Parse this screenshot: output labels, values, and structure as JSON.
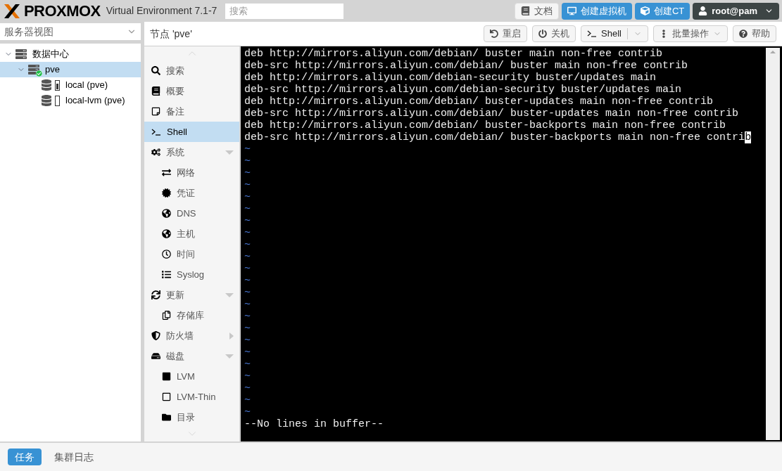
{
  "header": {
    "logo": "PROXMOX",
    "product": "Virtual Environment 7.1-7",
    "search": {
      "placeholder": "搜索"
    },
    "buttons": [
      {
        "label": "文档",
        "kind": "plain"
      },
      {
        "label": "创建虚拟机",
        "kind": "primary"
      },
      {
        "label": "创建CT",
        "kind": "primary"
      },
      {
        "label": "root@pam",
        "kind": "user"
      }
    ]
  },
  "sidebar": {
    "view_select": "服务器视图",
    "tree": [
      {
        "label": "数据中心",
        "expanded": true,
        "selected": false,
        "children": [
          {
            "label": "pve",
            "expanded": true,
            "selected": true,
            "children": [
              {
                "label": "local (pve)",
                "selected": false
              },
              {
                "label": "local-lvm (pve)",
                "selected": false
              }
            ]
          }
        ]
      }
    ]
  },
  "panel": {
    "title": "节点 'pve'",
    "toolbar": [
      {
        "label": "重启",
        "kind": "button"
      },
      {
        "label": "关机",
        "kind": "button"
      },
      {
        "label": "Shell",
        "kind": "split"
      },
      {
        "label": "批量操作",
        "kind": "menu"
      },
      {
        "label": "帮助",
        "kind": "button"
      }
    ]
  },
  "nav": [
    {
      "label": "搜索",
      "kind": "item",
      "selected": false
    },
    {
      "label": "概要",
      "kind": "item",
      "selected": false
    },
    {
      "label": "备注",
      "kind": "item",
      "selected": false
    },
    {
      "label": "Shell",
      "kind": "item",
      "selected": true
    },
    {
      "label": "系统",
      "kind": "group",
      "expanded": true,
      "selected": false
    },
    {
      "label": "网络",
      "kind": "child",
      "selected": false
    },
    {
      "label": "凭证",
      "kind": "child",
      "selected": false
    },
    {
      "label": "DNS",
      "kind": "child",
      "selected": false
    },
    {
      "label": "主机",
      "kind": "child",
      "selected": false
    },
    {
      "label": "时间",
      "kind": "child",
      "selected": false
    },
    {
      "label": "Syslog",
      "kind": "child",
      "selected": false
    },
    {
      "label": "更新",
      "kind": "group",
      "expanded": true,
      "selected": false
    },
    {
      "label": "存储库",
      "kind": "child",
      "selected": false
    },
    {
      "label": "防火墙",
      "kind": "group",
      "expanded": false,
      "selected": false
    },
    {
      "label": "磁盘",
      "kind": "group",
      "expanded": true,
      "selected": false
    },
    {
      "label": "LVM",
      "kind": "child",
      "selected": false
    },
    {
      "label": "LVM-Thin",
      "kind": "child",
      "selected": false
    },
    {
      "label": "目录",
      "kind": "child",
      "selected": false
    }
  ],
  "terminal": {
    "lines": [
      {
        "text": "deb http://mirrors.aliyun.com/debian/ buster main non-free contrib",
        "cursor": false
      },
      {
        "text": "deb-src http://mirrors.aliyun.com/debian/ buster main non-free contrib",
        "cursor": false
      },
      {
        "text": "deb http://mirrors.aliyun.com/debian-security buster/updates main",
        "cursor": false
      },
      {
        "text": "deb-src http://mirrors.aliyun.com/debian-security buster/updates main",
        "cursor": false
      },
      {
        "text": "deb http://mirrors.aliyun.com/debian/ buster-updates main non-free contrib",
        "cursor": false
      },
      {
        "text": "deb-src http://mirrors.aliyun.com/debian/ buster-updates main non-free contrib",
        "cursor": false
      },
      {
        "text": "deb http://mirrors.aliyun.com/debian/ buster-backports main non-free contrib",
        "cursor": false
      },
      {
        "text": "deb-src http://mirrors.aliyun.com/debian/ buster-backports main non-free contrib",
        "cursor": true
      }
    ],
    "tildes": [
      "~",
      "~",
      "~",
      "~",
      "~",
      "~",
      "~",
      "~",
      "~",
      "~",
      "~",
      "~",
      "~",
      "~",
      "~",
      "~",
      "~",
      "~",
      "~",
      "~",
      "~",
      "~",
      "~"
    ],
    "status": "--No lines in buffer--"
  },
  "footer": {
    "tabs": [
      {
        "label": "任务",
        "selected": true
      },
      {
        "label": "集群日志",
        "selected": false
      }
    ]
  }
}
